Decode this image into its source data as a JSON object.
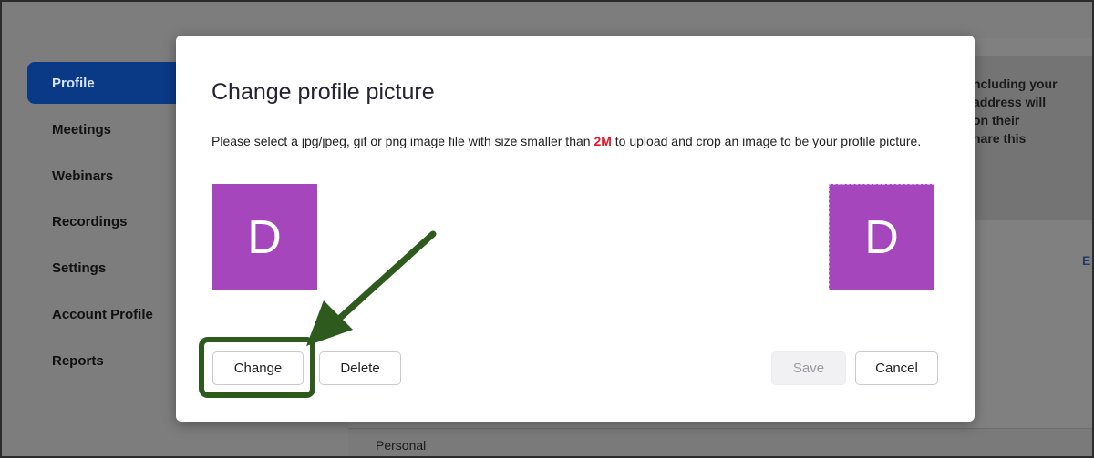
{
  "sidebar": {
    "items": [
      {
        "label": "Profile",
        "active": true
      },
      {
        "label": "Meetings"
      },
      {
        "label": "Webinars"
      },
      {
        "label": "Recordings"
      },
      {
        "label": "Settings"
      },
      {
        "label": "Account Profile"
      },
      {
        "label": "Reports"
      }
    ]
  },
  "background": {
    "info_text": "ncluding your\n address will\non their\nhare this",
    "edit_link": "E",
    "section_label": "Personal"
  },
  "modal": {
    "title": "Change profile picture",
    "desc_before": "Please select a jpg/jpeg, gif or png image file with size smaller than ",
    "desc_highlight": "2M",
    "desc_after": " to upload and crop an image to be your profile picture.",
    "avatar_letter": "D",
    "buttons": {
      "change": "Change",
      "delete": "Delete",
      "save": "Save",
      "cancel": "Cancel"
    }
  },
  "colors": {
    "avatar": "#a646bd",
    "sidebar_active": "#0a3a86",
    "highlight": "#e5192b",
    "annotation": "#2e5a1e"
  }
}
